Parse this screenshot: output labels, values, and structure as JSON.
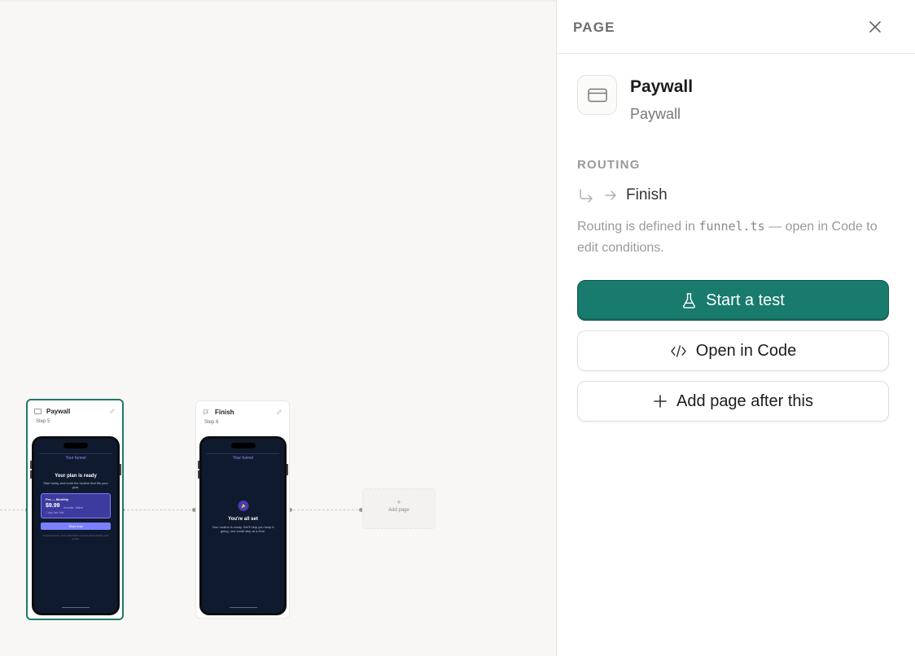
{
  "canvas": {
    "nodes": [
      {
        "title": "Paywall",
        "step": "Step 5",
        "screen": {
          "brand": "Your funnel",
          "heading": "Your plan is ready",
          "subtitle": "Start today and build the routine that fits your goal.",
          "plan_name": "Pro — Monthly",
          "price": "$9.99",
          "price_note": "/month, billed",
          "trial": "7-day free trial",
          "cta": "Start now",
          "fine_print": "Cancel anytime. Your subscription renews automatically each period."
        }
      },
      {
        "title": "Finish",
        "step": "Step 6",
        "screen": {
          "brand": "Your funnel",
          "heading": "You're all set",
          "subtitle": "Your routine is ready. We'll help you keep it going, one small step at a time."
        }
      }
    ],
    "add_page": {
      "plus": "+",
      "label": "Add page"
    }
  },
  "panel": {
    "title": "PAGE",
    "page_name": "Paywall",
    "page_type": "Paywall",
    "routing_label": "ROUTING",
    "route_target": "Finish",
    "note_before": "Routing is defined in ",
    "note_code": "funnel.ts",
    "note_after": " — open in Code to edit conditions.",
    "buttons": {
      "start_test": "Start a test",
      "open_code": "Open in Code",
      "add_page": "Add page after this"
    }
  },
  "colors": {
    "accent": "#187b6d",
    "selected_border": "#1e7a6b",
    "phone_screen": "#101a2e",
    "cta": "#7b80ff"
  },
  "icons": {
    "close": "close-icon",
    "card": "credit-card-icon",
    "route_branch": "corner-down-right-icon",
    "route_arrow": "arrow-right-icon",
    "test": "flask-icon",
    "code": "code-icon",
    "add": "plus-icon"
  }
}
